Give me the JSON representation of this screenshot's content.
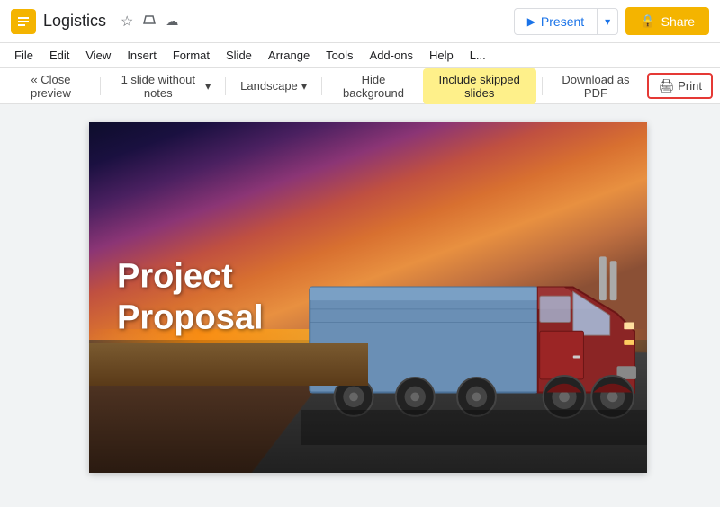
{
  "titleBar": {
    "appTitle": "Logistics",
    "presentLabel": "Present",
    "shareLabel": "Share",
    "lockIcon": "🔒"
  },
  "menuBar": {
    "items": [
      "File",
      "Edit",
      "View",
      "Insert",
      "Format",
      "Slide",
      "Arrange",
      "Tools",
      "Add-ons",
      "Help",
      "L..."
    ]
  },
  "toolbar": {
    "closePrev": "« Close preview",
    "slidesLabel": "1 slide without notes",
    "landscape": "Landscape",
    "hideBackground": "Hide background",
    "includeSkipped": "Include skipped slides",
    "downloadPdf": "Download as PDF",
    "print": "Print"
  },
  "slide": {
    "titleLine1": "Project",
    "titleLine2": "Proposal"
  },
  "icons": {
    "star": "☆",
    "drive": "📁",
    "cloud": "☁",
    "chevronDown": "▾",
    "present": "▶",
    "printer": "🖨"
  }
}
